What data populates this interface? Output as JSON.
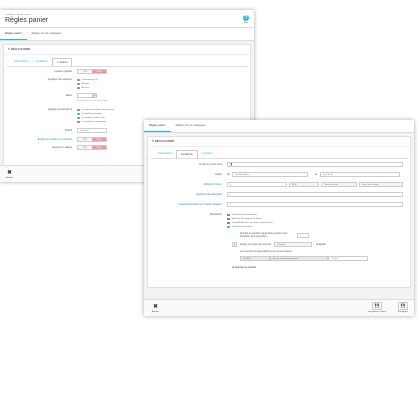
{
  "win1": {
    "breadcrumb": [
      "Catalogue",
      "Règles panier"
    ],
    "title": "Règles panier",
    "help": "Aide",
    "tabs": [
      "Règles panier",
      "Règles de prix catalogue"
    ],
    "panel_title": "RÈGLE PANIER",
    "subtabs": [
      "Informations",
      "Conditions",
      "Actions"
    ],
    "rows": {
      "free_shipping": "Livraison gratuite",
      "apply_discount": "Appliquer une réduction",
      "value": "Valeur",
      "apply_discount_to": "Appliquer la réduction à",
      "exclude": "Exclure les produits en promotion",
      "send_gift": "Envoyer un cadeau",
      "product": "Produit"
    },
    "toggle_no": "NON",
    "toggle_yes": "OUI",
    "discount_options": [
      "Pourcentage (%)",
      "Montant",
      "Aucune"
    ],
    "value_unit": "%",
    "value_note": "Ne s'applique pas aux frais de port",
    "discount_to_options": [
      "La commande (hors frais de port)",
      "Un produit spécifique",
      "Le produit le moins cher",
      "Les produits sélectionnés"
    ],
    "product_placeholder": "Chercher",
    "cancel": "Annuler"
  },
  "win2": {
    "title": "",
    "tabs": [
      "Règles panier",
      "Règles de prix catalogue"
    ],
    "panel_title": "RÈGLE PANIER",
    "subtabs": [
      "Informations",
      "Conditions",
      "Actions"
    ],
    "rows": {
      "customer": "Limiter à un seul client",
      "validity": "Validité",
      "min_amount": "Montant minimum",
      "total_available": "Quantité totale disponible",
      "per_user": "Quantité disponible pour chaque utilisateur",
      "restrictions": "Restrictions"
    },
    "validity_from": "De",
    "validity_to": "au",
    "validity_start": "Date de début",
    "validity_end": "Date de fin",
    "amount_value": "0",
    "currency": "EUR",
    "tax": "Taxes incluses",
    "shipping": "Hors frais de port",
    "total_value": "1",
    "user_value": "1",
    "restrictions": [
      "Sélection de transporteurs",
      "Sélection de groupes de clients",
      "Compatibilité avec les autres règles panier",
      "Sélection de produits"
    ],
    "product_rule_text": "Nombre de produits requis dans le panier pour bénéficier de la promotion :",
    "product_qty": "1",
    "add_rule_text": "Ajouter une règle qui concerne",
    "rule_type": "Produits",
    "add_button": "Ajouter",
    "products_match_text": "Les produits correspondants à l'une de ces critères :",
    "products_label": "Produits",
    "products_value": "Aucun produit sélectionné",
    "choose": "Choisir",
    "product_selection_link": "Sélection de produits",
    "cancel": "Annuler",
    "save_stay": "Enregistrer et rester",
    "save": "Enregistrer"
  },
  "colors": {
    "accent": "#25b9d7",
    "no": "#ea9c9c",
    "bg": "#f1f3f4"
  }
}
